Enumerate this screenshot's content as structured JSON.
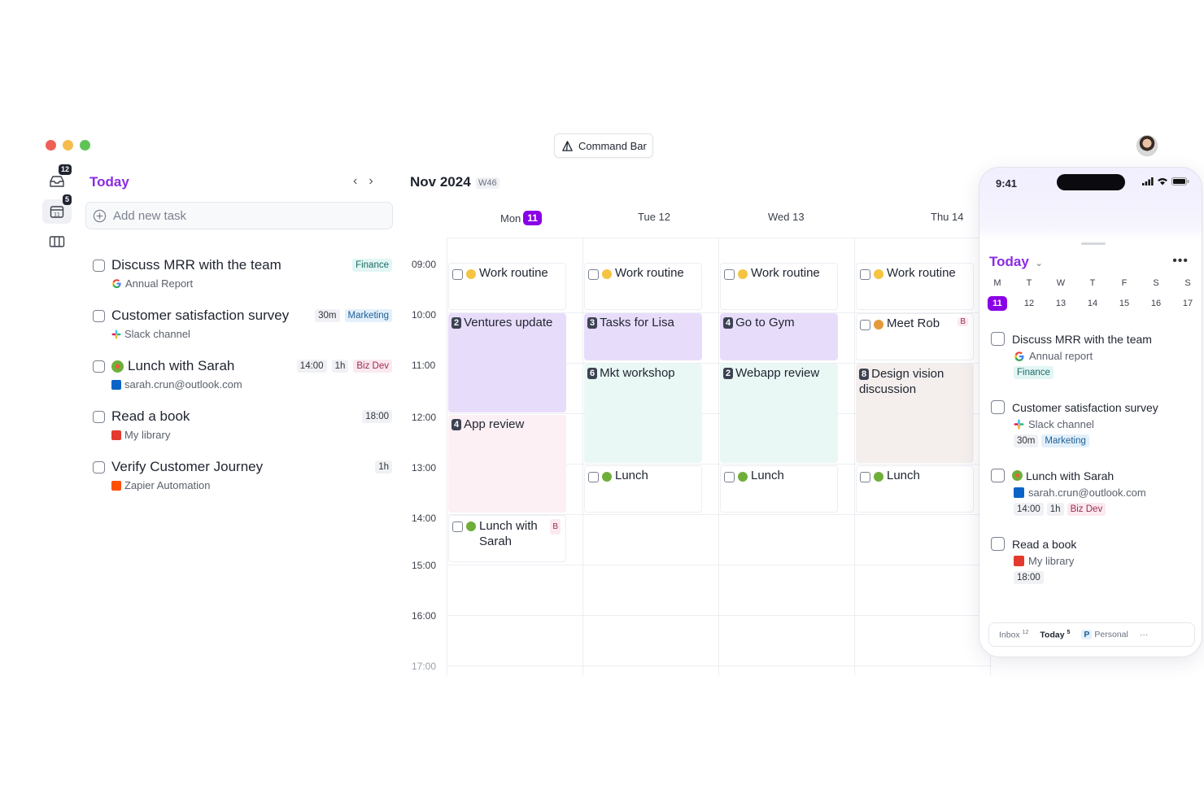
{
  "window": {
    "command_bar_label": "Command Bar",
    "traffic_colors": [
      "#ee5f57",
      "#f5bd4f",
      "#5ec456"
    ]
  },
  "rail": {
    "items": [
      {
        "icon": "inbox-icon",
        "badge": "12"
      },
      {
        "icon": "calendar-today-icon",
        "badge": "5",
        "day": "11"
      },
      {
        "icon": "columns-icon",
        "badge": ""
      }
    ]
  },
  "tasks_panel": {
    "title": "Today",
    "add_placeholder": "Add new task",
    "tasks": [
      {
        "title": "Discuss MRR with the team",
        "source": "Annual Report",
        "source_icon": "google-icon",
        "chips": [
          {
            "text": "Finance",
            "style": "teal"
          }
        ]
      },
      {
        "title": "Customer satisfaction survey",
        "source": "Slack channel",
        "source_icon": "slack-icon",
        "chips": [
          {
            "text": "30m",
            "style": "gray"
          },
          {
            "text": "Marketing",
            "style": "blue"
          }
        ]
      },
      {
        "title": "Lunch with Sarah",
        "source": "sarah.crun@outlook.com",
        "source_icon": "outlook-icon",
        "chips": [
          {
            "text": "14:00",
            "style": "gray"
          },
          {
            "text": "1h",
            "style": "gray"
          },
          {
            "text": "Biz Dev",
            "style": "pink"
          }
        ]
      },
      {
        "title": "Read a book",
        "source": "My library",
        "source_icon": "library-icon",
        "chips": [
          {
            "text": "18:00",
            "style": "gray"
          }
        ]
      },
      {
        "title": "Verify Customer Journey",
        "source": "Zapier Automation",
        "source_icon": "zapier-icon",
        "chips": [
          {
            "text": "1h",
            "style": "gray"
          }
        ]
      }
    ]
  },
  "calendar": {
    "month": "Nov 2024",
    "week": "W46",
    "days": [
      {
        "label": "Mon",
        "num": "11",
        "today": true
      },
      {
        "label": "Tue 12",
        "num": "",
        "today": false
      },
      {
        "label": "Wed 13",
        "num": "",
        "today": false
      },
      {
        "label": "Thu 14",
        "num": "",
        "today": false
      }
    ],
    "hours": [
      "09:00",
      "10:00",
      "11:00",
      "12:00",
      "13:00",
      "14:00",
      "15:00",
      "16:00",
      "17:00"
    ],
    "events": {
      "work_routine": "Work routine",
      "ventures_update": {
        "num": "2",
        "title": "Ventures update"
      },
      "tasks_for_lisa": {
        "num": "3",
        "title": "Tasks for Lisa"
      },
      "go_to_gym": {
        "num": "4",
        "title": "Go to Gym"
      },
      "meet_rob": {
        "title": "Meet Rob",
        "badge": "B"
      },
      "mkt_workshop": {
        "num": "6",
        "title": "Mkt workshop"
      },
      "webapp_review": {
        "num": "2",
        "title": "Webapp review"
      },
      "design_vision": {
        "num": "8",
        "title": "Design vision discussion"
      },
      "app_review": {
        "num": "4",
        "title": "App review"
      },
      "lunch": "Lunch",
      "lunch_with_sarah": {
        "title": "Lunch with Sarah",
        "badge": "B"
      }
    }
  },
  "phone": {
    "time": "9:41",
    "title": "Today",
    "week_letters": [
      "M",
      "T",
      "W",
      "T",
      "F",
      "S",
      "S"
    ],
    "week_nums": [
      "11",
      "12",
      "13",
      "14",
      "15",
      "16",
      "17"
    ],
    "tasks": [
      {
        "title": "Discuss MRR with the team",
        "source": "Annual report",
        "source_icon": "google-icon",
        "chips": [
          {
            "text": "Finance",
            "style": "teal"
          }
        ]
      },
      {
        "title": "Customer satisfaction survey",
        "source": "Slack channel",
        "source_icon": "slack-icon",
        "chips": [
          {
            "text": "30m",
            "style": "gray"
          },
          {
            "text": "Marketing",
            "style": "blue"
          }
        ]
      },
      {
        "title": "Lunch with Sarah",
        "source": "sarah.crun@outlook.com",
        "source_icon": "outlook-icon",
        "chips": [
          {
            "text": "14:00",
            "style": "gray"
          },
          {
            "text": "1h",
            "style": "gray"
          },
          {
            "text": "Biz Dev",
            "style": "pink"
          }
        ]
      },
      {
        "title": "Read a book",
        "source": "My library",
        "source_icon": "library-icon",
        "chips": [
          {
            "text": "18:00",
            "style": "gray"
          }
        ]
      }
    ],
    "tabs": {
      "inbox": "Inbox",
      "inbox_count": "12",
      "today": "Today",
      "today_count": "5",
      "personal_letter": "P",
      "personal": "Personal",
      "more": "···"
    }
  },
  "colors": {
    "accent": "#8a00e6",
    "title_purple": "#8a2be2"
  }
}
